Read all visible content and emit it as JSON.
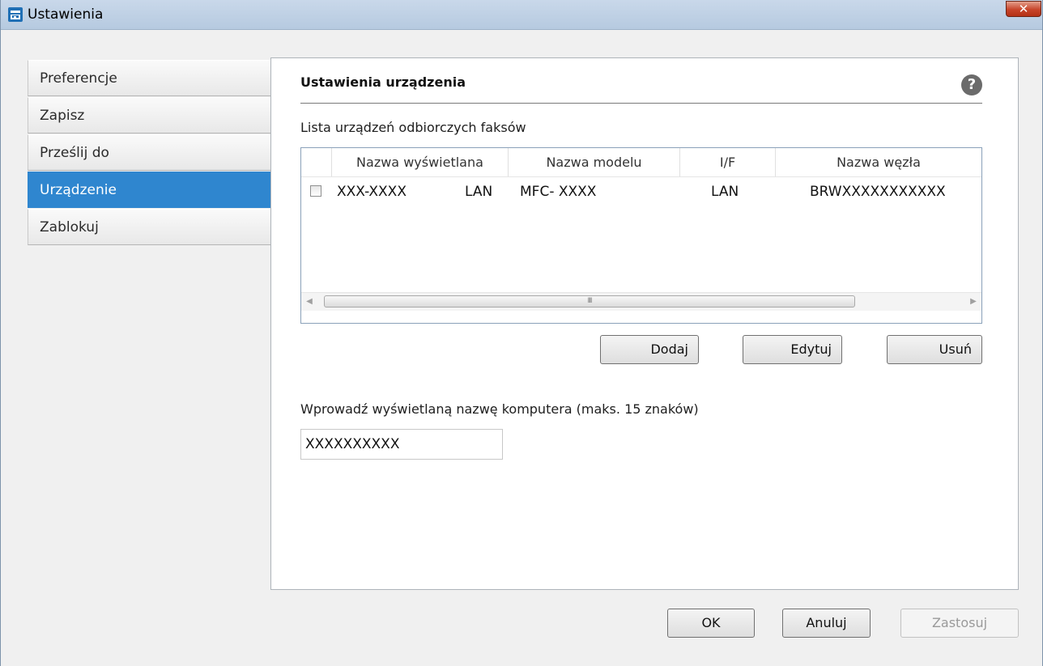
{
  "window": {
    "title": "Ustawienia",
    "close_label": "✕"
  },
  "sidebar": {
    "items": [
      {
        "label": "Preferencje"
      },
      {
        "label": "Zapisz"
      },
      {
        "label": "Prześlij do"
      },
      {
        "label": "Urządzenie",
        "active": true
      },
      {
        "label": "Zablokuj"
      }
    ]
  },
  "main": {
    "section_title": "Ustawienia urządzenia",
    "help_label": "?",
    "list_label": "Lista urządzeń odbiorczych faksów",
    "table": {
      "columns": [
        "Nazwa wyświetlana",
        "Nazwa modelu",
        "I/F",
        "Nazwa węzła"
      ],
      "rows": [
        {
          "checked": false,
          "display_name": "XXX-XXXX",
          "display_suffix": "LAN",
          "model": "MFC- XXXX",
          "interface": "LAN",
          "node": "BRWXXXXXXXXXXX"
        }
      ],
      "scroll_grip": "III"
    },
    "buttons": {
      "add": "Dodaj",
      "edit": "Edytuj",
      "delete": "Usuń"
    },
    "pc_name_label": "Wprowadź wyświetlaną nazwę komputera (maks. 15 znaków)",
    "pc_name_value": "XXXXXXXXXX"
  },
  "footer": {
    "ok": "OK",
    "cancel": "Anuluj",
    "apply": "Zastosuj"
  },
  "colors": {
    "accent": "#2f86cf",
    "titlebar": "#c3d4e8",
    "close": "#c7442a"
  }
}
